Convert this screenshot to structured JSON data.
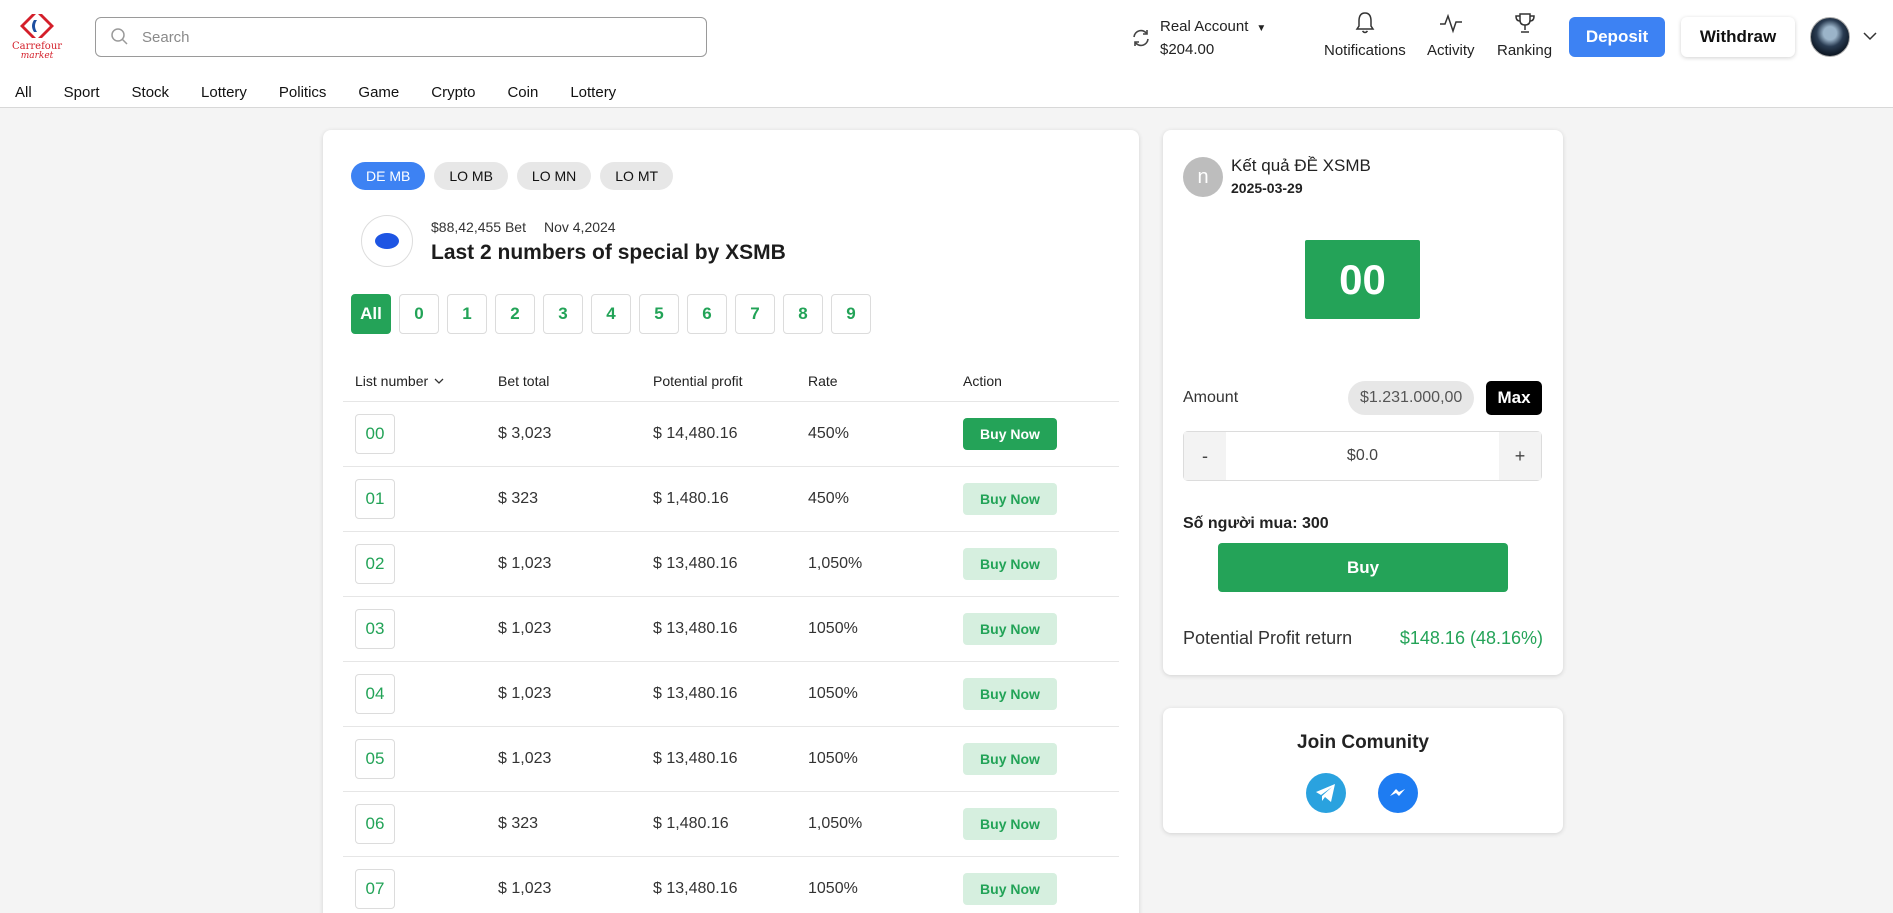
{
  "app": {
    "brand_line1": "Carrefour",
    "brand_line2": "market"
  },
  "search": {
    "placeholder": "Search"
  },
  "nav": {
    "items": [
      "All",
      "Sport",
      "Stock",
      "Lottery",
      "Politics",
      "Game",
      "Crypto",
      "Coin",
      "Lottery"
    ]
  },
  "account": {
    "type_label": "Real Account",
    "balance": "$204.00"
  },
  "header_buttons": {
    "notifications": "Notifications",
    "activity": "Activity",
    "ranking": "Ranking",
    "deposit": "Deposit",
    "withdraw": "Withdraw"
  },
  "market": {
    "tabs": [
      "DE MB",
      "LO MB",
      "LO MN",
      "LO MT"
    ],
    "active_tab": "DE MB",
    "bet_total": "$88,42,455 Bet",
    "date": "Nov 4,2024",
    "title": "Last 2 numbers of special by XSMB"
  },
  "filters": [
    "All",
    "0",
    "1",
    "2",
    "3",
    "4",
    "5",
    "6",
    "7",
    "8",
    "9"
  ],
  "table": {
    "headers": [
      "List number",
      "Bet total",
      "Potential profit",
      "Rate",
      "Action"
    ],
    "action_label": "Buy Now",
    "rows": [
      {
        "number": "00",
        "bet_total": "$ 3,023",
        "profit": "$ 14,480.16",
        "rate": "450%"
      },
      {
        "number": "01",
        "bet_total": "$ 323",
        "profit": "$ 1,480.16",
        "rate": "450%"
      },
      {
        "number": "02",
        "bet_total": "$ 1,023",
        "profit": "$ 13,480.16",
        "rate": "1,050%"
      },
      {
        "number": "03",
        "bet_total": "$ 1,023",
        "profit": "$ 13,480.16",
        "rate": "1050%"
      },
      {
        "number": "04",
        "bet_total": "$ 1,023",
        "profit": "$ 13,480.16",
        "rate": "1050%"
      },
      {
        "number": "05",
        "bet_total": "$ 1,023",
        "profit": "$ 13,480.16",
        "rate": "1050%"
      },
      {
        "number": "06",
        "bet_total": "$ 323",
        "profit": "$ 1,480.16",
        "rate": "1,050%"
      },
      {
        "number": "07",
        "bet_total": "$ 1,023",
        "profit": "$ 13,480.16",
        "rate": "1050%"
      }
    ]
  },
  "result": {
    "avatar_letter": "n",
    "title": "Kết quả ĐỀ XSMB",
    "date": "2025-03-29",
    "number": "00"
  },
  "bet_form": {
    "amount_label": "Amount",
    "amount_chip": "$1.231.000,00",
    "max_label": "Max",
    "minus_label": "-",
    "plus_label": "+",
    "value": "$0.0",
    "buyers_label": "Số người mua: 300",
    "buy_label": "Buy",
    "profit_label": "Potential Profit return",
    "profit_value": "$148.16 (48.16%)"
  },
  "community": {
    "title": "Join Comunity"
  },
  "colors": {
    "primary_blue": "#3d82f3",
    "green": "#24a358",
    "light_green": "#d6efdf",
    "brand_red": "#d41f2a"
  }
}
